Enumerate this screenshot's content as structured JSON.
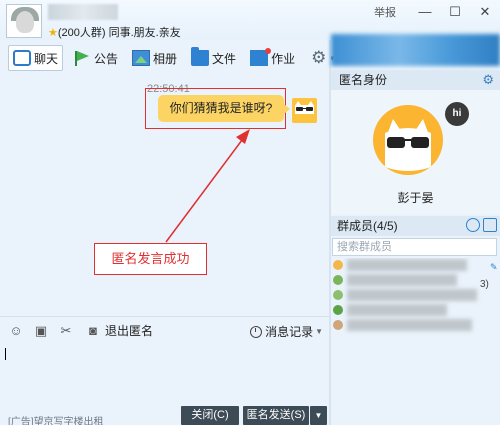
{
  "window": {
    "group_label": "(200人群) 同事.朋友.亲友",
    "report_label": "举报",
    "minimize_glyph": "—",
    "maximize_glyph": "☐",
    "close_glyph": "✕"
  },
  "toolbar": {
    "items": [
      {
        "label": "聊天",
        "icon": "chat-icon"
      },
      {
        "label": "公告",
        "icon": "announcement-icon"
      },
      {
        "label": "相册",
        "icon": "photo-icon"
      },
      {
        "label": "文件",
        "icon": "file-icon"
      },
      {
        "label": "作业",
        "icon": "homework-icon"
      }
    ],
    "more_glyph": "⚙"
  },
  "chat": {
    "timestamp": "22:50:41",
    "message": "你们猜猜我是谁呀?",
    "annotation": "匿名发言成功"
  },
  "input_toolbar": {
    "exit_anon_label": "退出匿名",
    "history_label": "消息记录"
  },
  "footer": {
    "ad_text": "[广告]望京写字楼出租",
    "close_btn": "关闭(C)",
    "send_btn": "匿名发送(S)",
    "dropdown_glyph": "▼"
  },
  "right_panel": {
    "anon_header": "匿名身份",
    "anon_name": "彭于晏",
    "hi_badge": "hi",
    "members_header": "群成员(4/5)",
    "member_search_placeholder": "搜索群成员",
    "side_glyph": "3)"
  },
  "colors": {
    "accent": "#2f82d2",
    "bubble": "#fcd463",
    "annotation_red": "#e03030",
    "avatar_yellow": "#fbb531"
  }
}
